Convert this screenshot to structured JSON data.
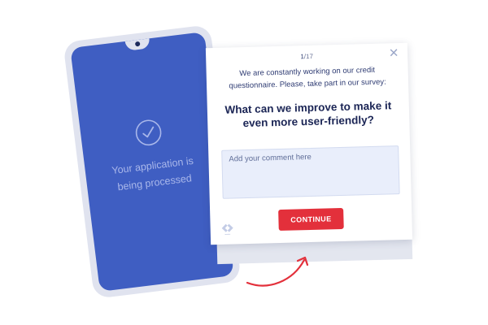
{
  "phone": {
    "status_line1": "Your application is",
    "status_line2": "being processed",
    "screen_color": "#3f5ec2",
    "icon": "check-circle-icon"
  },
  "survey": {
    "counter_current": "1",
    "counter_total": "/17",
    "intro_line1": "We are constantly working on our credit",
    "intro_line2": "questionnaire. Please, take part in our survey:",
    "question_line1": "What can we improve to make it",
    "question_line2": "even more user-friendly?",
    "comment_placeholder": "Add your comment here",
    "continue_label": "CONTINUE",
    "close_icon": "close-icon",
    "brand_logo": "brand-logo-icon",
    "accent_color": "#e3303b"
  },
  "arrow": {
    "icon": "curved-arrow-icon",
    "color": "#e3303b"
  }
}
